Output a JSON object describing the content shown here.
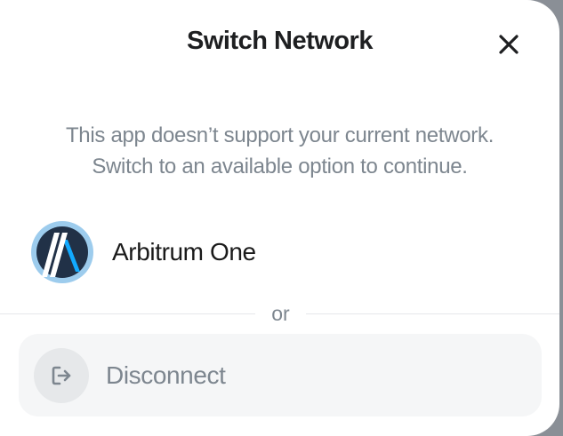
{
  "modal": {
    "title": "Switch Network",
    "subtitle_line1": "This app doesn’t support your current network.",
    "subtitle_line2": "Switch to an available option to continue."
  },
  "networks": [
    {
      "name": "Arbitrum One",
      "icon": "arbitrum-logo"
    }
  ],
  "divider_text": "or",
  "disconnect": {
    "label": "Disconnect",
    "icon": "logout-icon"
  },
  "colors": {
    "title": "#1e1f21",
    "muted": "#7d868f",
    "panel": "#f5f6f7",
    "arbitrum_dark": "#213147",
    "arbitrum_blue": "#12aaff"
  }
}
